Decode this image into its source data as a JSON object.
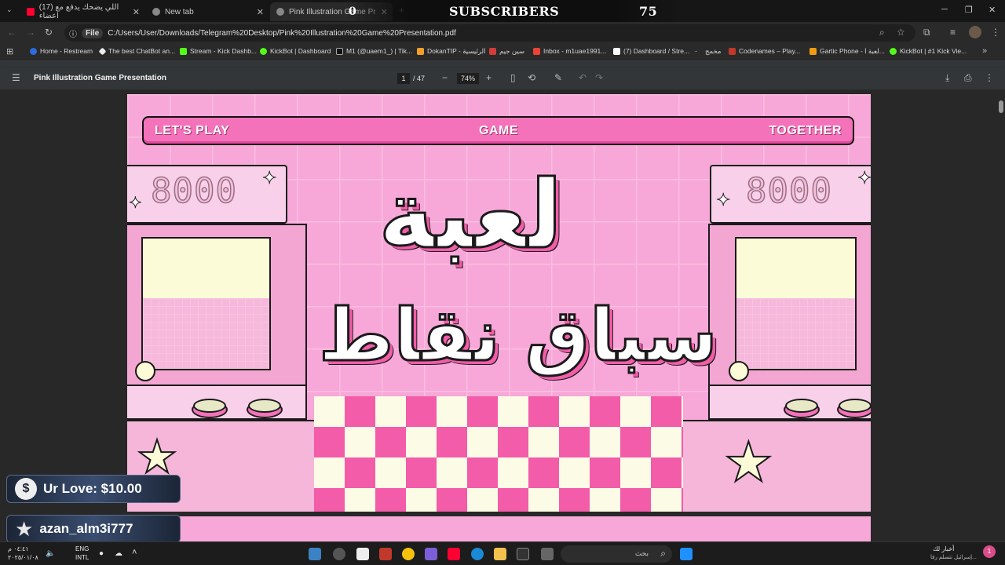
{
  "tabs": [
    {
      "title": "(17) اللي يضحك يدفع مع اعضاء"
    },
    {
      "title": "New tab"
    },
    {
      "title": "Pink Illustration Game Presenta"
    }
  ],
  "stream_overlay": {
    "subscribers_label": "SUBSCRIBERS",
    "subscribers_left": "0",
    "subscribers_count": "75",
    "donation": "Ur Love: $10.00",
    "follower": "azan_alm3i777"
  },
  "address": {
    "chip": "File",
    "url": "C:/Users/User/Downloads/Telegram%20Desktop/Pink%20Illustration%20Game%20Presentation.pdf"
  },
  "bookmarks": [
    {
      "label": "Home - Restream",
      "color": "#2d6cdf"
    },
    {
      "label": "The best ChatBot an...",
      "color": "#eeeeee"
    },
    {
      "label": "Stream - Kick Dashb...",
      "color": "#53fc18"
    },
    {
      "label": "KickBot | Dashboard",
      "color": "#53fc18"
    },
    {
      "label": "M1 (@uaem1_) | Tik...",
      "color": "#111111"
    },
    {
      "label": "DokanTIP - الرئيسية",
      "color": "#f59f2b"
    },
    {
      "label": "سين جيم",
      "color": "#d43b3b"
    },
    {
      "label": "Inbox - m1uae1991...",
      "color": "#ea4335"
    },
    {
      "label": "(7) Dashboard / Stre...",
      "color": "#ffffff"
    },
    {
      "label": "مخمج",
      "color": "#888888"
    },
    {
      "label": "Codenames – Play...",
      "color": "#c0392b"
    },
    {
      "label": "Gartic Phone - لعبة ا...",
      "color": "#f39c12"
    },
    {
      "label": "KickBot | #1 Kick Vie...",
      "color": "#53fc18"
    }
  ],
  "pdf": {
    "title": "Pink Illustration Game Presentation",
    "page": "1",
    "total": "/ 47",
    "zoom": "74%"
  },
  "slide": {
    "banner_left": "LET'S PLAY",
    "banner_center": "GAME",
    "banner_right": "TOGETHER",
    "score_left": "8000",
    "score_right": "8000",
    "title_line1": "لعبة",
    "title_line2": "سباق نقاط"
  },
  "taskbar": {
    "time": "٠٤:٤١ م",
    "date": "٢٠٢٥/٠١/٠٨",
    "lang1": "ENG",
    "lang2": "INTL",
    "search_placeholder": "بحث",
    "news_title": "أخبار لك",
    "news_sub": "إسرائيل تتسلم رفا...",
    "badge": "1"
  }
}
